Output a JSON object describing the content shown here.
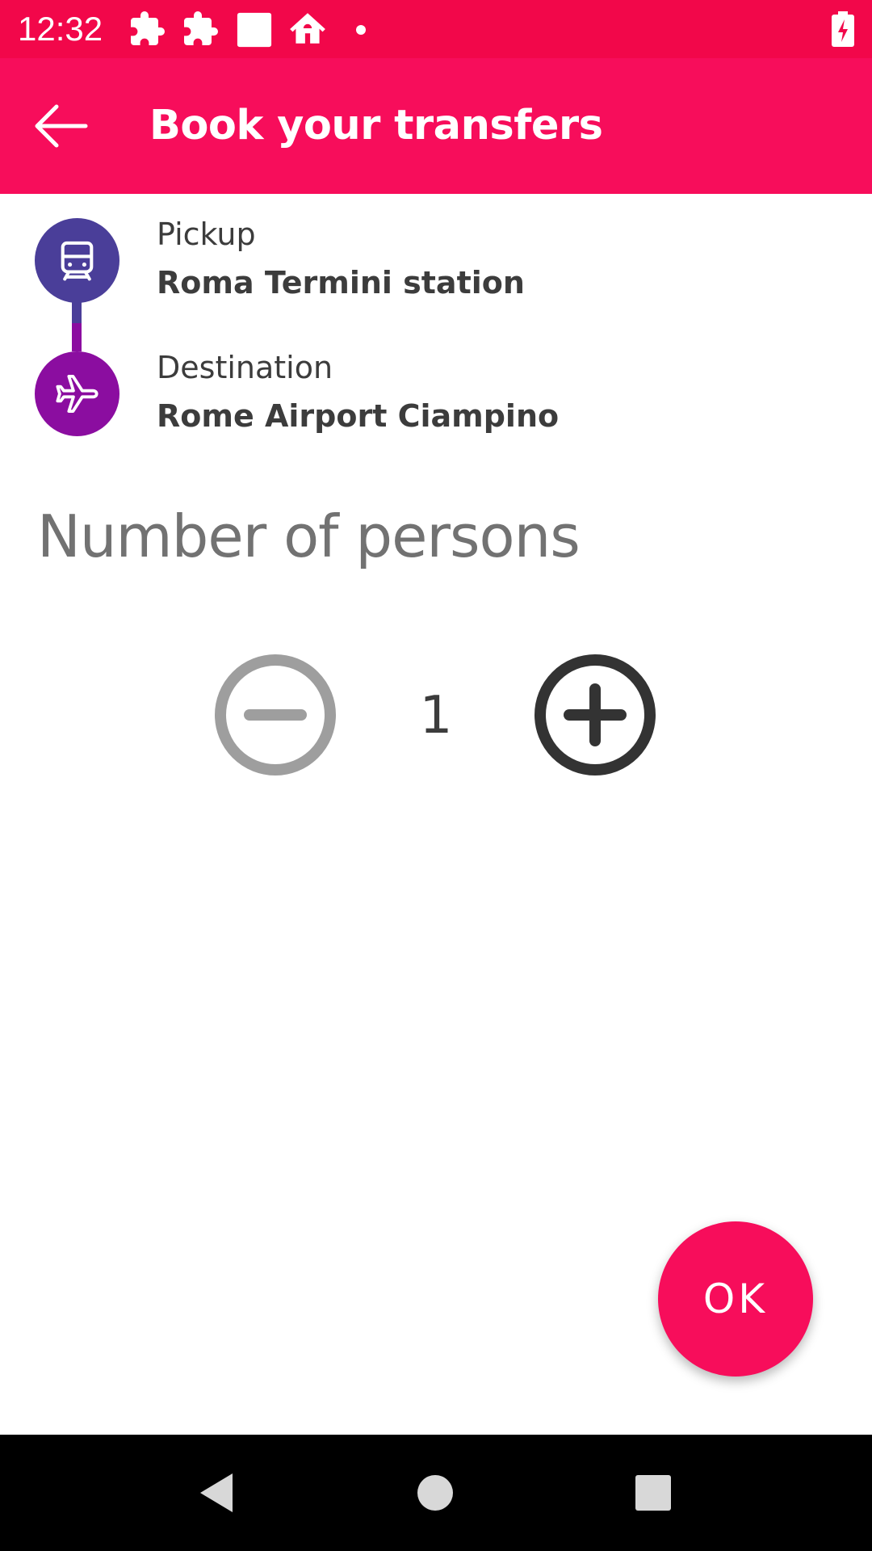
{
  "status_bar": {
    "time": "12:32",
    "icons": [
      "puzzle-icon",
      "puzzle-icon",
      "square-icon",
      "home-icon",
      "dot-icon",
      "battery-charging-icon"
    ]
  },
  "app_bar": {
    "title": "Book your transfers",
    "back_icon": "arrow-left-icon"
  },
  "route": {
    "pickup": {
      "label": "Pickup",
      "value": "Roma Termini station",
      "icon": "train-icon",
      "color": "#4A3E99"
    },
    "destination": {
      "label": "Destination",
      "value": "Rome Airport Ciampino",
      "icon": "airplane-icon",
      "color": "#8B0DA0"
    }
  },
  "persons": {
    "title": "Number of persons",
    "count": "1",
    "minus_icon": "minus-circle-icon",
    "plus_icon": "plus-circle-icon"
  },
  "actions": {
    "ok_label": "OK"
  },
  "navigation": {
    "buttons": [
      "back-triangle-icon",
      "home-circle-icon",
      "recents-square-icon"
    ]
  },
  "colors": {
    "status_bar": "#F2074A",
    "accent": "#F70D5B",
    "text": "#3c3c3c",
    "muted_text": "#727272"
  }
}
